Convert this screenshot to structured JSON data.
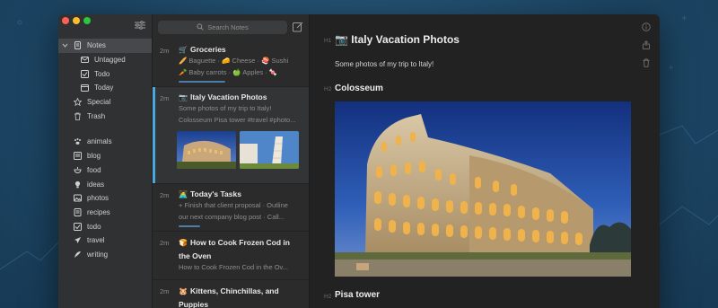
{
  "sidebar": {
    "items": [
      {
        "label": "Notes",
        "icon": "notes-icon",
        "level": 0,
        "active": true,
        "expanded": true
      },
      {
        "label": "Untagged",
        "icon": "untagged-icon",
        "level": 1
      },
      {
        "label": "Todo",
        "icon": "todo-icon",
        "level": 1
      },
      {
        "label": "Today",
        "icon": "today-icon",
        "level": 1
      },
      {
        "label": "Special",
        "icon": "star-icon",
        "level": 0
      },
      {
        "label": "Trash",
        "icon": "trash-icon",
        "level": 0
      }
    ],
    "tags": [
      {
        "label": "animals",
        "icon": "paw-icon"
      },
      {
        "label": "blog",
        "icon": "blog-icon"
      },
      {
        "label": "food",
        "icon": "food-icon"
      },
      {
        "label": "ideas",
        "icon": "lightbulb-icon"
      },
      {
        "label": "photos",
        "icon": "photo-icon"
      },
      {
        "label": "recipes",
        "icon": "recipe-icon"
      },
      {
        "label": "todo",
        "icon": "checkbox-icon"
      },
      {
        "label": "travel",
        "icon": "plane-icon"
      },
      {
        "label": "writing",
        "icon": "feather-icon"
      }
    ]
  },
  "search": {
    "placeholder": "Search Notes"
  },
  "notes": [
    {
      "time": "2m",
      "emoji": "🛒",
      "title": "Groceries",
      "lines": [
        "🥖 Baguette · 🧀 Cheese · 🍣 Sushi",
        "🥕 Baby carrots · 🍏 Apples · 🍬"
      ]
    },
    {
      "time": "2m",
      "emoji": "📷",
      "title": "Italy Vacation Photos",
      "lines": [
        "Some photos of my trip to Italy!",
        "Colosseum Pisa tower #travel #photo..."
      ]
    },
    {
      "time": "2m",
      "emoji": "🧑‍💻",
      "title": "Today's Tasks",
      "lines": [
        "+ Finish that client proposal · Outline",
        "our next company blog post · Call..."
      ]
    },
    {
      "time": "2m",
      "emoji": "🍞",
      "title": "How to Cook Frozen Cod in the Oven",
      "lines": [
        "How to Cook Frozen Cod in the Ov..."
      ]
    },
    {
      "time": "2m",
      "emoji": "🐹",
      "title": "Kittens, Chinchillas, and Puppies",
      "lines": []
    }
  ],
  "editor": {
    "h1_tag": "H1",
    "h2_tag": "H2",
    "title": "📷 Italy Vacation Photos",
    "paragraph": "Some photos of my trip to Italy!",
    "section1": "Colosseum",
    "section2": "Pisa tower"
  },
  "colors": {
    "accent": "#4aa8e0",
    "window_bg": "#2a2a2a",
    "sidebar_bg": "#303132"
  }
}
